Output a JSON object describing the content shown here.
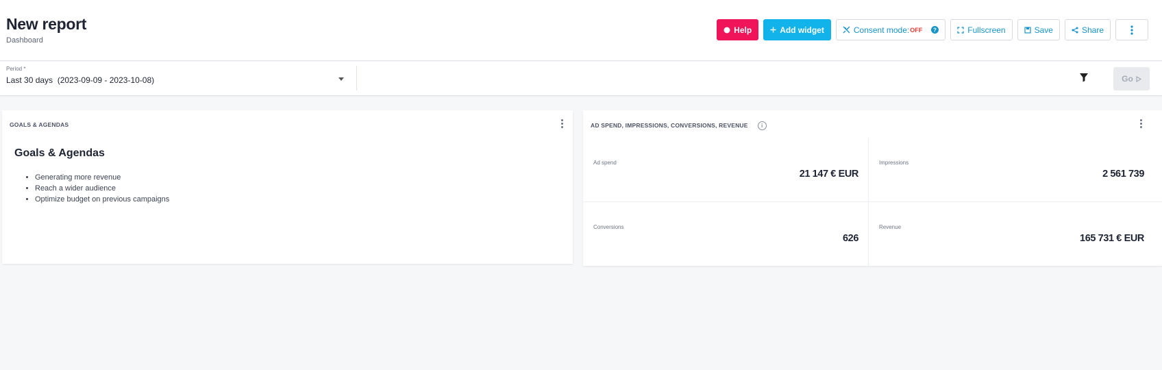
{
  "header": {
    "title": "New report",
    "subtitle": "Dashboard",
    "buttons": {
      "help": "Help",
      "add_widget": "Add widget",
      "consent_mode": "Consent mode:",
      "consent_state": "OFF",
      "fullscreen": "Fullscreen",
      "save": "Save",
      "share": "Share"
    }
  },
  "filter": {
    "period_label": "Period *",
    "period_value": "Last 30 days  (2023-09-09 - 2023-10-08)",
    "go_label": "Go"
  },
  "widgets": {
    "goals": {
      "title": "GOALS & AGENDAS",
      "heading": "Goals & Agendas",
      "items": [
        "Generating more revenue",
        "Reach a wider audience",
        "Optimize budget on previous campaigns"
      ]
    },
    "metrics": {
      "title": "AD SPEND, IMPRESSIONS, CONVERSIONS, REVENUE",
      "items": [
        {
          "label": "Ad spend",
          "value": "21 147 € EUR"
        },
        {
          "label": "Impressions",
          "value": "2 561 739"
        },
        {
          "label": "Conversions",
          "value": "626"
        },
        {
          "label": "Revenue",
          "value": "165 731 € EUR"
        }
      ]
    }
  },
  "colors": {
    "help": "#f0145a",
    "add": "#12b3ea",
    "link": "#1793c9",
    "off": "#e53935"
  }
}
